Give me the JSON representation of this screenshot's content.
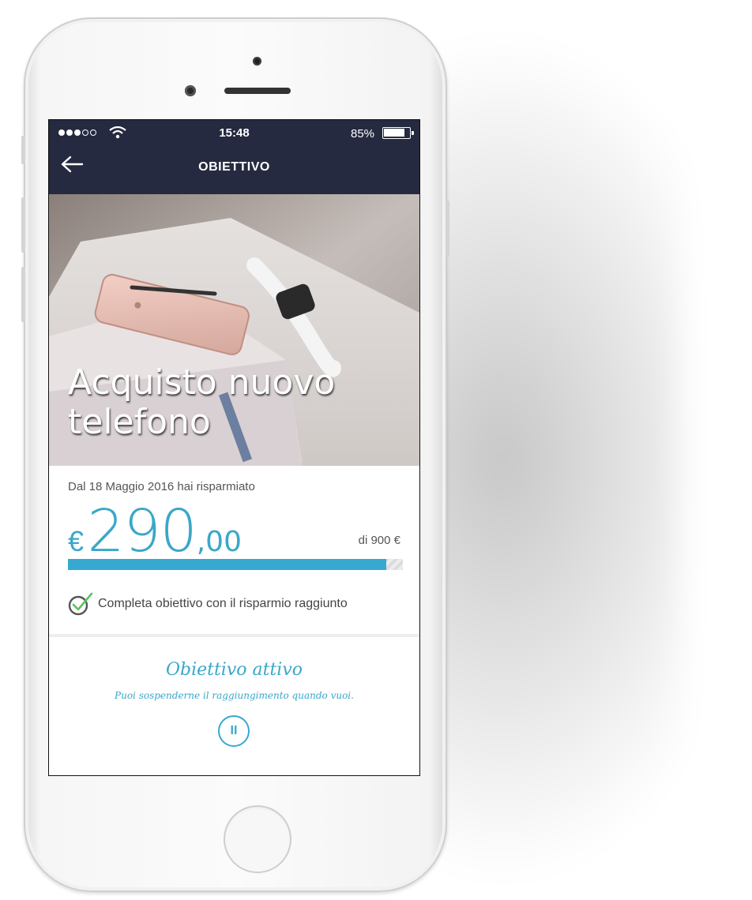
{
  "status_bar": {
    "time": "15:48",
    "battery_percent": "85%",
    "battery_level": 0.85,
    "signal_bars_filled": 3,
    "signal_bars_total": 5
  },
  "header": {
    "title": "OBIETTIVO",
    "back_icon": "arrow-left-icon",
    "background": "#252a40"
  },
  "hero": {
    "title": "Acquisto nuovo telefono"
  },
  "savings": {
    "since_text": "Dal 18 Maggio 2016 hai risparmiato",
    "currency": "€",
    "amount_integer": "290",
    "amount_decimal": ",00",
    "target_text": "di 900 €",
    "progress_fraction": 0.95,
    "accent_color": "#36a9d1"
  },
  "option": {
    "label": "Completa obiettivo con il risparmio raggiunto",
    "checked": true,
    "icon": "check-circle-icon"
  },
  "status": {
    "title": "Obiettivo attivo",
    "subtitle": "Puoi sospenderne il raggiungimento quando vuoi.",
    "action_icon": "pause-icon",
    "action_label": "II"
  }
}
